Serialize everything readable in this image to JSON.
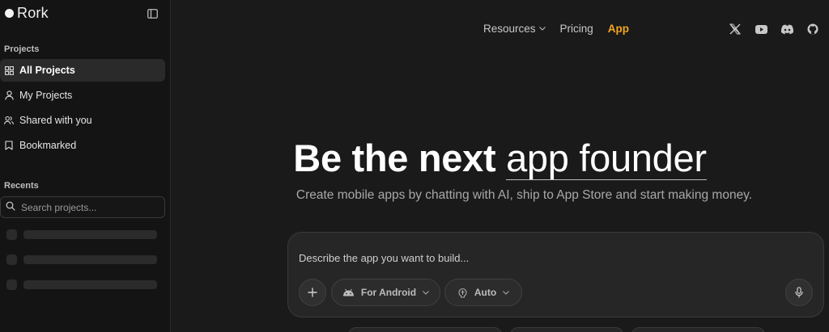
{
  "sidebar": {
    "brand": "Rork",
    "projects_label": "Projects",
    "nav": [
      {
        "label": "All Projects",
        "icon": "grid-icon",
        "active": true
      },
      {
        "label": "My Projects",
        "icon": "user-icon"
      },
      {
        "label": "Shared with you",
        "icon": "users-icon"
      },
      {
        "label": "Bookmarked",
        "icon": "bookmark-icon"
      }
    ],
    "recents_label": "Recents",
    "search_placeholder": "Search projects..."
  },
  "topnav": {
    "resources": "Resources",
    "pricing": "Pricing",
    "app": "App"
  },
  "hero": {
    "title_prefix": "Be the next ",
    "title_highlight": "app founder",
    "subtitle": "Create mobile apps by chatting with AI, ship to App Store and start making money."
  },
  "prompt": {
    "placeholder": "Describe the app you want to build...",
    "platform": "For Android",
    "mode": "Auto"
  },
  "colors": {
    "accent": "#f5a524",
    "background": "#1a1a1a",
    "sidebar": "#141414"
  }
}
